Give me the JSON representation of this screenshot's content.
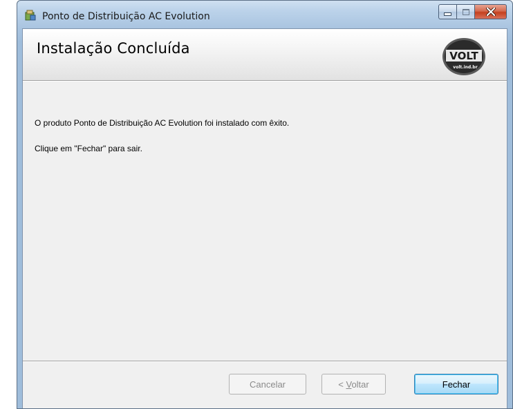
{
  "window": {
    "title": "Ponto de Distribuição AC Evolution"
  },
  "banner": {
    "title": "Instalação Concluída",
    "logo_text": "VOLT",
    "logo_subtext": "volt.ind.br"
  },
  "content": {
    "line1": "O produto Ponto de Distribuição AC Evolution foi instalado com êxito.",
    "line2": "Clique em \"Fechar\" para sair."
  },
  "buttons": {
    "cancel": "Cancelar",
    "back_prefix": "< ",
    "back_mnemonic": "V",
    "back_rest": "oltar",
    "close": "Fechar"
  },
  "colors": {
    "window_frame": "#a9c4e0",
    "close_button": "#c4401f",
    "default_button_border": "#3c7fb1"
  }
}
